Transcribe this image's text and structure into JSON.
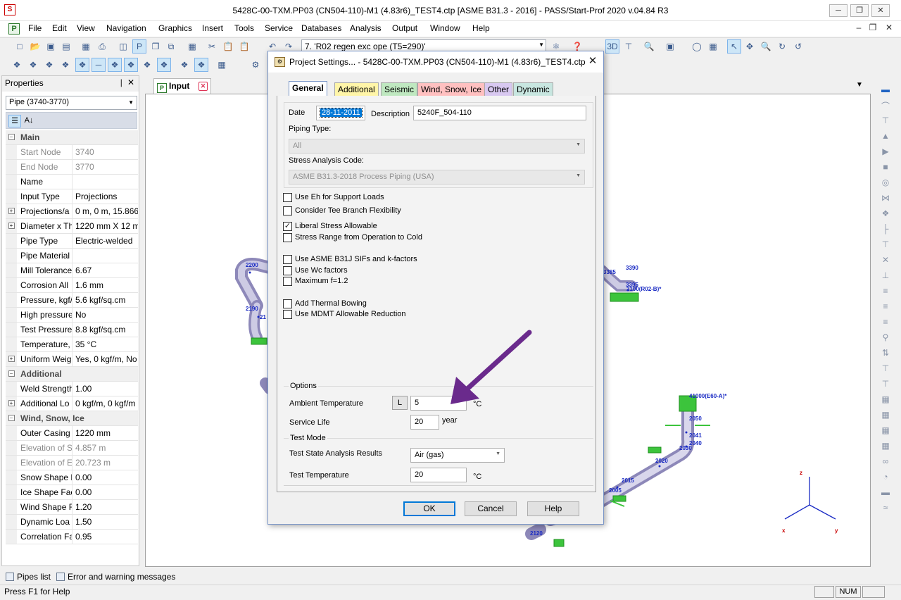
{
  "window": {
    "title": "5428C-00-TXM.PP03 (CN504-110)-M1 (4.83r6)_TEST4.ctp [ASME B31.3 - 2016] - PASS/Start-Prof 2020 v.04.84 R3",
    "app_icon_glyph": "S"
  },
  "menu": [
    "File",
    "Edit",
    "View",
    "Navigation",
    "Graphics",
    "Insert",
    "Tools",
    "Service",
    "Databases",
    "Analysis",
    "Output",
    "Window",
    "Help"
  ],
  "toolbar": {
    "load_case": "7. 'R02 regen exc ope (T5=290)'"
  },
  "properties": {
    "title": "Properties",
    "selector": "Pipe (3740-3770)",
    "rows": [
      {
        "type": "cat",
        "name": "Main"
      },
      {
        "type": "row",
        "name": "Start Node",
        "value": "3740",
        "grey": true
      },
      {
        "type": "row",
        "name": "End Node",
        "value": "3770",
        "grey": true
      },
      {
        "type": "row",
        "name": "Name",
        "value": ""
      },
      {
        "type": "row",
        "name": "Input Type",
        "value": "Projections"
      },
      {
        "type": "row",
        "name": "Projections/a",
        "value": "0 m, 0 m, 15.866",
        "exp": true
      },
      {
        "type": "row",
        "name": "Diameter x Th",
        "value": "1220 mm X 12 m",
        "exp": true
      },
      {
        "type": "row",
        "name": "Pipe Type",
        "value": "Electric-welded"
      },
      {
        "type": "row",
        "name": "Pipe Material",
        "value": ""
      },
      {
        "type": "row",
        "name": "Mill Tolerance",
        "value": "6.67"
      },
      {
        "type": "row",
        "name": "Corrosion All",
        "value": "1.6 mm"
      },
      {
        "type": "row",
        "name": "Pressure, kgf/",
        "value": "5.6 kgf/sq.cm"
      },
      {
        "type": "row",
        "name": "High pressure",
        "value": "No"
      },
      {
        "type": "row",
        "name": "Test Pressure,",
        "value": "8.8 kgf/sq.cm"
      },
      {
        "type": "row",
        "name": "Temperature,",
        "value": "35 °C"
      },
      {
        "type": "row",
        "name": "Uniform Weig",
        "value": "Yes, 0 kgf/m, No",
        "exp": true
      },
      {
        "type": "cat",
        "name": "Additional"
      },
      {
        "type": "row",
        "name": "Weld Strength",
        "value": "1.00"
      },
      {
        "type": "row",
        "name": "Additional Lo",
        "value": "0 kgf/m, 0 kgf/m",
        "exp": true
      },
      {
        "type": "cat",
        "name": "Wind, Snow, Ice"
      },
      {
        "type": "row",
        "name": "Outer Casing",
        "value": "1220 mm"
      },
      {
        "type": "row",
        "name": "Elevation of S",
        "value": "4.857 m",
        "grey": true
      },
      {
        "type": "row",
        "name": "Elevation of E",
        "value": "20.723 m",
        "grey": true
      },
      {
        "type": "row",
        "name": "Snow Shape F",
        "value": "0.00"
      },
      {
        "type": "row",
        "name": "Ice Shape Fac",
        "value": "0.00"
      },
      {
        "type": "row",
        "name": "Wind Shape F",
        "value": "1.20"
      },
      {
        "type": "row",
        "name": "Dynamic Loa",
        "value": "1.50"
      },
      {
        "type": "row",
        "name": "Correlation Fa",
        "value": "0.95"
      }
    ]
  },
  "doc": {
    "tab_label": "Input"
  },
  "drawing": {
    "nodes": [
      "2200",
      "2190",
      "21",
      "3385",
      "3390",
      "3395",
      "2100(R02-B)*",
      "41000(E60-A)*",
      "2050",
      "2041",
      "2040",
      "2030",
      "2020",
      "2015",
      "2005",
      "2120"
    ],
    "axes": {
      "z": "z",
      "x": "x",
      "y": "y"
    }
  },
  "dialog": {
    "title": "Project Settings... - 5428C-00-TXM.PP03 (CN504-110)-M1 (4.83r6)_TEST4.ctp",
    "tabs": [
      "General",
      "Additional",
      "Seismic",
      "Wind, Snow, Ice",
      "Other",
      "Dynamic"
    ],
    "date_label": "Date",
    "date_value": "28-11-2011",
    "description_label": "Description",
    "description_value": "5240F_504-110",
    "piping_type_label": "Piping Type:",
    "piping_type_value": "All",
    "code_label": "Stress Analysis Code:",
    "code_value": "ASME B31.3-2018 Process Piping (USA)",
    "checks": [
      {
        "label": "Use Eh for Support Loads",
        "checked": false
      },
      {
        "label": "Consider Tee Branch Flexibility",
        "checked": false
      },
      {
        "label": "Liberal Stress Allowable",
        "checked": true
      },
      {
        "label": "Stress Range from Operation to Cold",
        "checked": false
      },
      {
        "label": "Use ASME B31J SIFs and k-factors",
        "checked": false
      },
      {
        "label": "Use Wc factors",
        "checked": false
      },
      {
        "label": "Maximum f=1.2",
        "checked": false
      },
      {
        "label": "Add Thermal Bowing",
        "checked": false
      },
      {
        "label": "Use MDMT Allowable Reduction",
        "checked": false
      }
    ],
    "options_label": "Options",
    "ambient_label": "Ambient Temperature",
    "ambient_btn": "L",
    "ambient_value": "5",
    "ambient_unit": "°C",
    "service_life_label": "Service Life",
    "service_life_value": "20",
    "service_life_unit": "year",
    "test_mode_label": "Test Mode",
    "test_results_label": "Test State Analysis Results",
    "test_results_value": "Air (gas)",
    "test_temp_label": "Test Temperature",
    "test_temp_value": "20",
    "test_temp_unit": "°C",
    "ok": "OK",
    "cancel": "Cancel",
    "help": "Help"
  },
  "bottom_tabs": [
    "Pipes list",
    "Error and warning messages"
  ],
  "status": {
    "text": "Press F1 for Help",
    "num": "NUM"
  },
  "colors": {
    "arrow": "#6a2a8c",
    "pipe": "#b9b6d6",
    "support": "#3cc43c",
    "node_label": "#1a2bc4"
  }
}
